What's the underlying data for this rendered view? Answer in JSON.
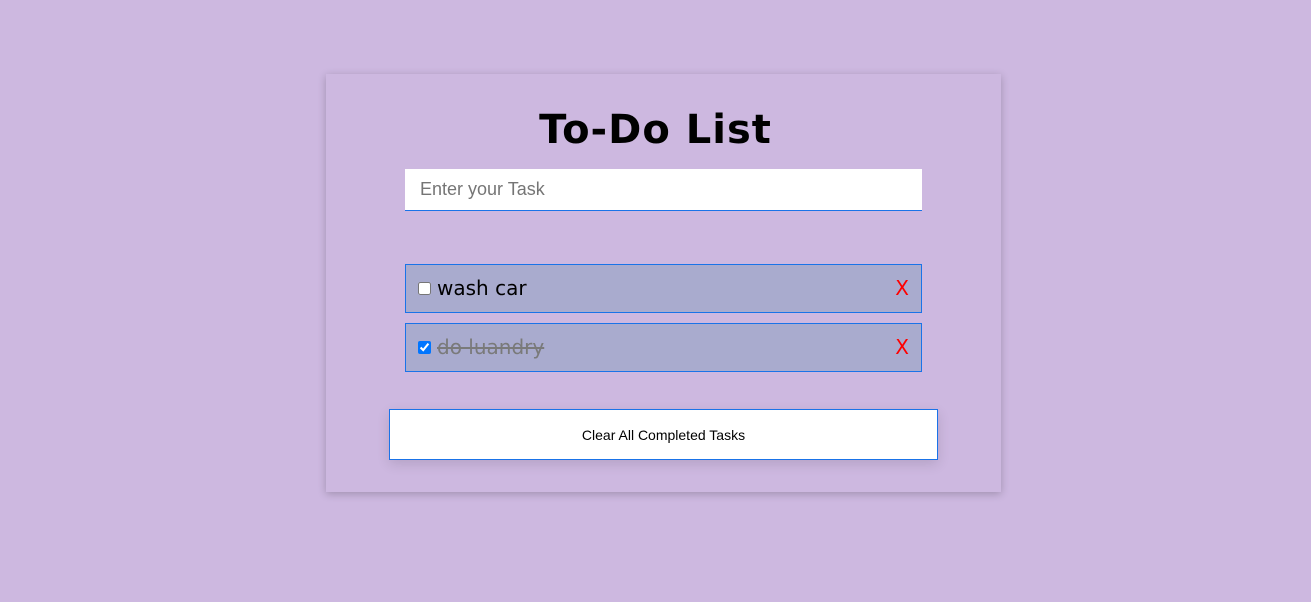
{
  "app": {
    "title": "To-Do List"
  },
  "input": {
    "placeholder": "Enter your Task",
    "value": ""
  },
  "tasks": [
    {
      "label": "wash car",
      "completed": false,
      "delete_label": "X"
    },
    {
      "label": "do luandry",
      "completed": true,
      "delete_label": "X"
    }
  ],
  "actions": {
    "clear_completed_label": "Clear All Completed Tasks"
  },
  "colors": {
    "page_background": "#cdb8e0",
    "task_background": "#a9abce",
    "accent_border": "#1a73e8",
    "delete_color": "#ff0000",
    "completed_text": "#7a7a7a"
  }
}
